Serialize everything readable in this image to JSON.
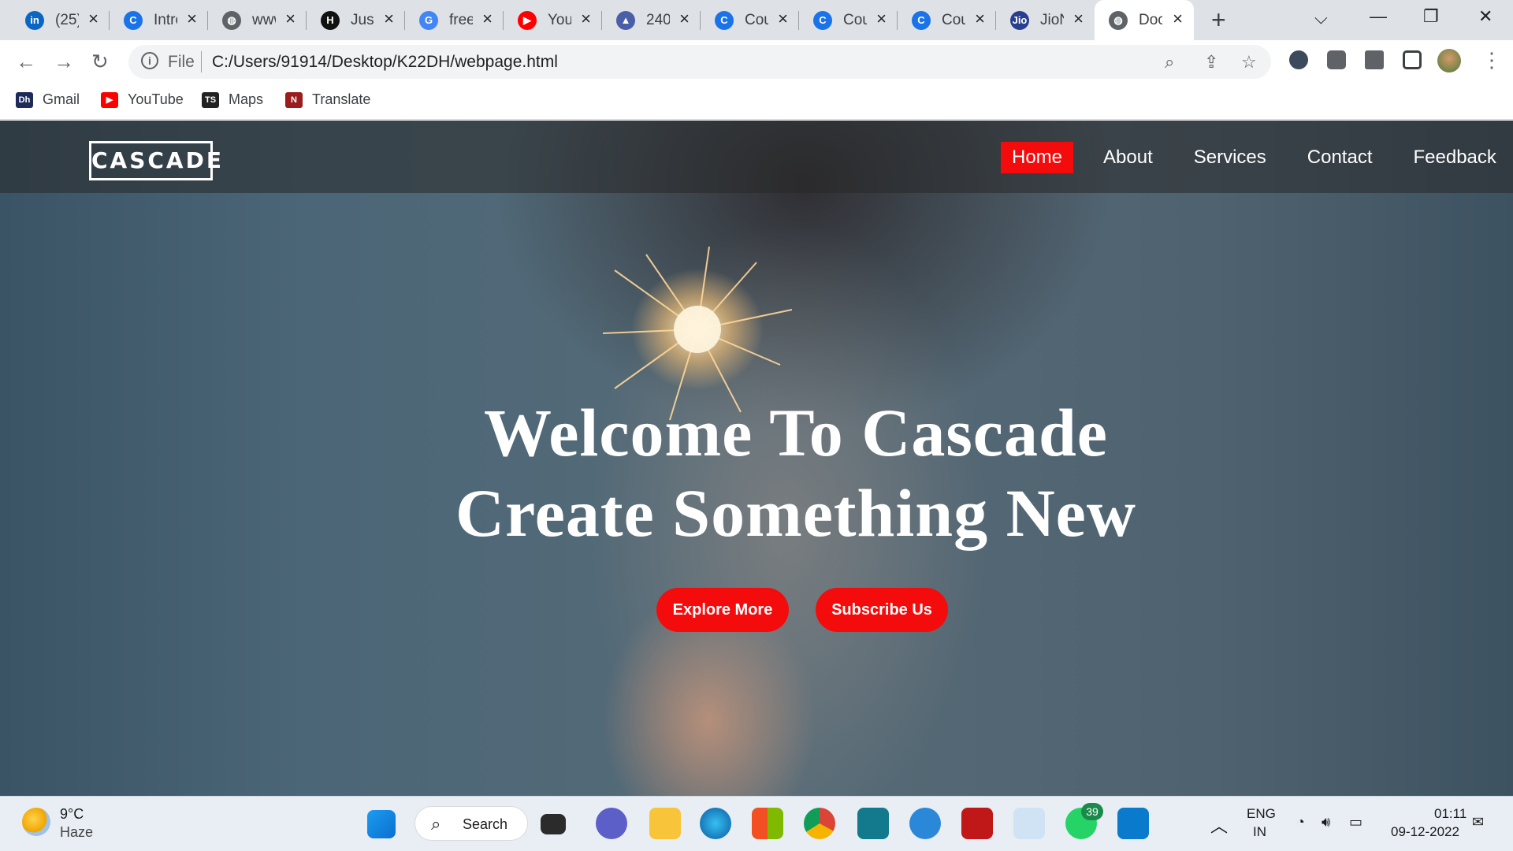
{
  "browser": {
    "tabs": [
      {
        "title": "(25)",
        "favicon": "linkedin-icon",
        "color": "#0a66c2",
        "glyph": "in"
      },
      {
        "title": "Intro",
        "favicon": "c-icon",
        "color": "#1a73e8",
        "glyph": "C"
      },
      {
        "title": "www",
        "favicon": "globe-icon",
        "color": "#5f6368",
        "glyph": "◍"
      },
      {
        "title": "Just",
        "favicon": "hackerrank-icon",
        "color": "#111111",
        "glyph": "H"
      },
      {
        "title": "free",
        "favicon": "google-icon",
        "color": "#4285f4",
        "glyph": "G"
      },
      {
        "title": "You",
        "favicon": "youtube-icon",
        "color": "#ff0000",
        "glyph": "▶"
      },
      {
        "title": "240",
        "favicon": "mountain-icon",
        "color": "#4a5fa8",
        "glyph": "▲"
      },
      {
        "title": "Cou",
        "favicon": "c-icon",
        "color": "#1a73e8",
        "glyph": "C"
      },
      {
        "title": "Cou",
        "favicon": "c-icon",
        "color": "#1a73e8",
        "glyph": "C"
      },
      {
        "title": "Cou",
        "favicon": "c-icon",
        "color": "#1a73e8",
        "glyph": "C"
      },
      {
        "title": "JioN",
        "favicon": "jio-icon",
        "color": "#2a3e8f",
        "glyph": "Jio"
      },
      {
        "title": "Doc",
        "favicon": "globe-icon",
        "color": "#5f6368",
        "glyph": "◍"
      }
    ],
    "active_tab": 11,
    "file_label": "File",
    "url": "C:/Users/91914/Desktop/K22DH/webpage.html",
    "bookmarks": [
      {
        "label": "Gmail",
        "icon": "dh-icon",
        "color": "#1e2a5a",
        "glyph": "Dh"
      },
      {
        "label": "YouTube",
        "icon": "youtube-icon",
        "color": "#ff0000",
        "glyph": "▶"
      },
      {
        "label": "Maps",
        "icon": "ts-icon",
        "color": "#222222",
        "glyph": "TS"
      },
      {
        "label": "Translate",
        "icon": "n-icon",
        "color": "#9b1c1c",
        "glyph": "N"
      }
    ]
  },
  "site": {
    "logo": "CASCADE",
    "nav": [
      "Home",
      "About",
      "Services",
      "Contact",
      "Feedback"
    ],
    "active_nav": 0,
    "headline_1": "Welcome To Cascade",
    "headline_2": "Create Something New",
    "button_1": "Explore More",
    "button_2": "Subscribe Us",
    "accent": "#f40b0b"
  },
  "taskbar": {
    "weather_temp": "9°C",
    "weather_desc": "Haze",
    "search_label": "Search",
    "whatsapp_badge": "39",
    "lang_1": "ENG",
    "lang_2": "IN",
    "time": "01:11",
    "date": "09-12-2022"
  }
}
